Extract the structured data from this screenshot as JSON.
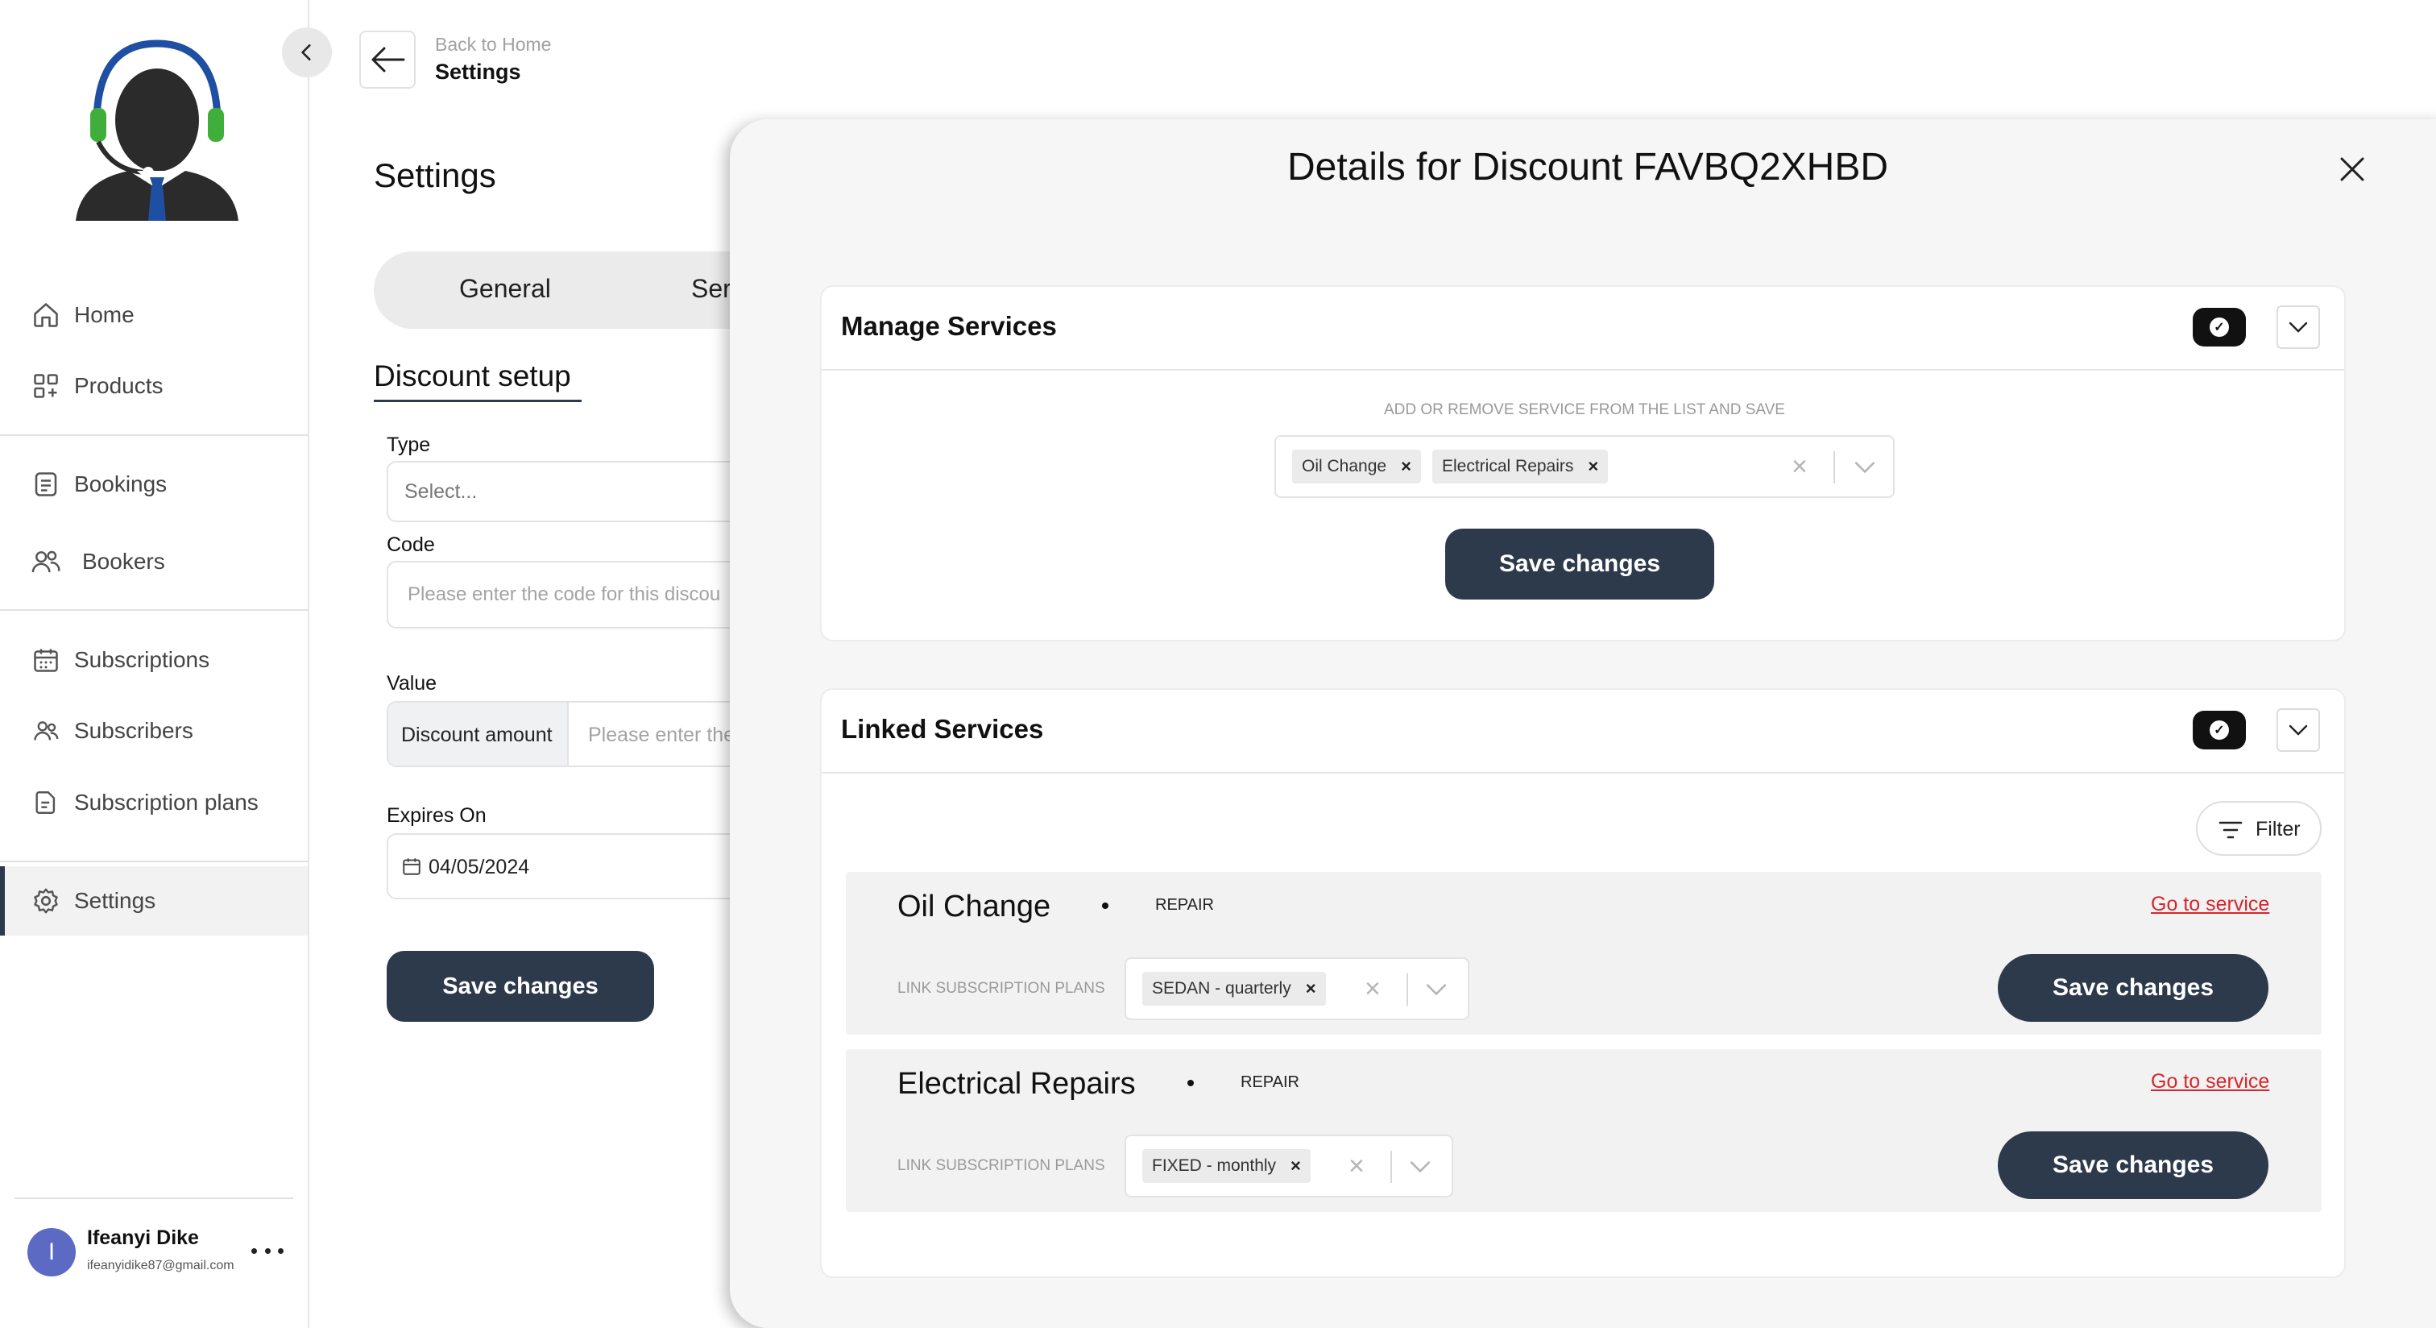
{
  "sidebar": {
    "collapse_icon": "chevron-left-icon",
    "items": [
      {
        "label": "Home",
        "icon": "home-icon"
      },
      {
        "label": "Products",
        "icon": "grid-plus-icon"
      },
      {
        "label": "Bookings",
        "icon": "document-list-icon"
      },
      {
        "label": "Bookers",
        "icon": "users-icon"
      },
      {
        "label": "Subscriptions",
        "icon": "calendar-icon"
      },
      {
        "label": "Subscribers",
        "icon": "users-outline-icon"
      },
      {
        "label": "Subscription plans",
        "icon": "file-icon"
      },
      {
        "label": "Settings",
        "icon": "gear-icon"
      }
    ],
    "user": {
      "initial": "I",
      "name": "Ifeanyi Dike",
      "email": "ifeanyidike87@gmail.com"
    }
  },
  "header": {
    "back_label": "Back to Home",
    "title": "Settings"
  },
  "main": {
    "page_title": "Settings",
    "tabs": [
      {
        "label": "General"
      },
      {
        "label": "Ser"
      }
    ],
    "section_title": "Discount setup",
    "type_label": "Type",
    "type_placeholder": "Select...",
    "code_label": "Code",
    "code_placeholder": "Please enter the code for this discou",
    "value_label": "Value",
    "value_addon": "Discount amount",
    "value_placeholder": "Please enter the",
    "expires_label": "Expires On",
    "expires_value": "04/05/2024",
    "save_label": "Save changes"
  },
  "modal": {
    "title": "Details for Discount FAVBQ2XHBD",
    "manage": {
      "title": "Manage Services",
      "hint": "ADD OR REMOVE SERVICE FROM THE LIST AND SAVE",
      "chips": [
        "Oil Change",
        "Electrical Repairs"
      ],
      "save_label": "Save changes"
    },
    "linked": {
      "title": "Linked Services",
      "filter_label": "Filter",
      "services": [
        {
          "name": "Oil Change",
          "category": "REPAIR",
          "go_label": "Go to service",
          "plans_label": "LINK SUBSCRIPTION PLANS",
          "chip": "SEDAN - quarterly",
          "save_label": "Save changes"
        },
        {
          "name": "Electrical Repairs",
          "category": "REPAIR",
          "go_label": "Go to service",
          "plans_label": "LINK SUBSCRIPTION PLANS",
          "chip": "FIXED - monthly",
          "save_label": "Save changes"
        }
      ]
    }
  },
  "colors": {
    "primary": "#2d3a4b",
    "link": "#d7262b",
    "avatar": "#5c6ac4",
    "headset": "#1f4fa3",
    "earcup": "#3fae3a"
  }
}
